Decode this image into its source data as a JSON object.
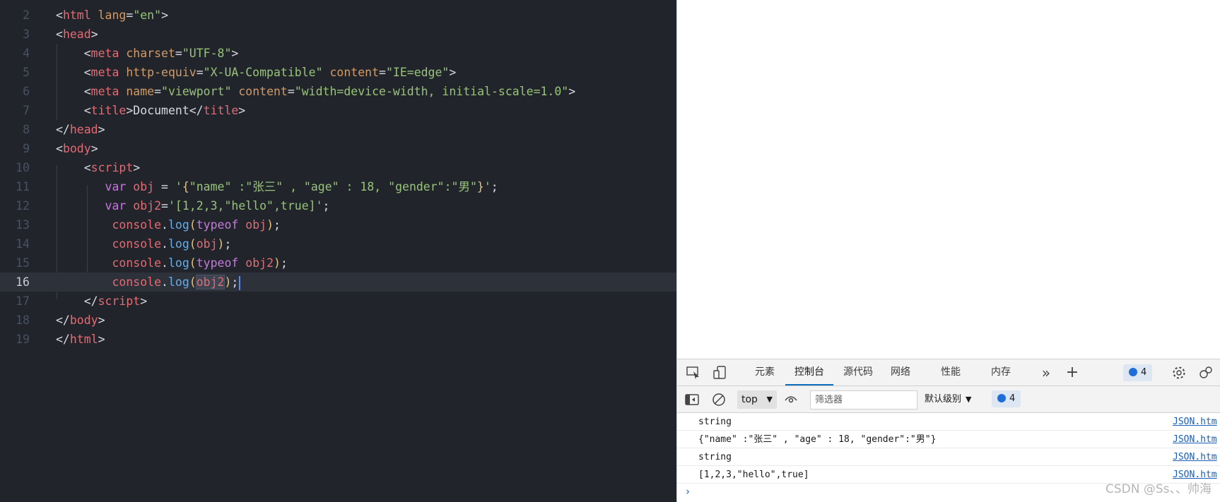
{
  "editor": {
    "lines": [
      {
        "num": "2",
        "current": false
      },
      {
        "num": "3",
        "current": false
      },
      {
        "num": "4",
        "current": false
      },
      {
        "num": "5",
        "current": false
      },
      {
        "num": "6",
        "current": false
      },
      {
        "num": "7",
        "current": false
      },
      {
        "num": "8",
        "current": false
      },
      {
        "num": "9",
        "current": false
      },
      {
        "num": "10",
        "current": false
      },
      {
        "num": "11",
        "current": false
      },
      {
        "num": "12",
        "current": false
      },
      {
        "num": "13",
        "current": false
      },
      {
        "num": "14",
        "current": false
      },
      {
        "num": "15",
        "current": false
      },
      {
        "num": "16",
        "current": true
      },
      {
        "num": "17",
        "current": false
      },
      {
        "num": "18",
        "current": false
      },
      {
        "num": "19",
        "current": false
      }
    ],
    "code": [
      [
        [
          "t-text",
          "<"
        ],
        [
          "t-tag",
          "html"
        ],
        [
          "t-text",
          " "
        ],
        [
          "t-attr",
          "lang"
        ],
        [
          "t-text",
          "="
        ],
        [
          "t-str",
          "\"en\""
        ],
        [
          "t-text",
          ">"
        ]
      ],
      [
        [
          "t-text",
          "<"
        ],
        [
          "t-tag",
          "head"
        ],
        [
          "t-text",
          ">"
        ]
      ],
      [
        [
          "t-text",
          "    <"
        ],
        [
          "t-tag",
          "meta"
        ],
        [
          "t-text",
          " "
        ],
        [
          "t-attr",
          "charset"
        ],
        [
          "t-text",
          "="
        ],
        [
          "t-str",
          "\"UTF-8\""
        ],
        [
          "t-text",
          ">"
        ]
      ],
      [
        [
          "t-text",
          "    <"
        ],
        [
          "t-tag",
          "meta"
        ],
        [
          "t-text",
          " "
        ],
        [
          "t-attr",
          "http-equiv"
        ],
        [
          "t-text",
          "="
        ],
        [
          "t-str",
          "\"X-UA-Compatible\""
        ],
        [
          "t-text",
          " "
        ],
        [
          "t-attr",
          "content"
        ],
        [
          "t-text",
          "="
        ],
        [
          "t-str",
          "\"IE=edge\""
        ],
        [
          "t-text",
          ">"
        ]
      ],
      [
        [
          "t-text",
          "    <"
        ],
        [
          "t-tag",
          "meta"
        ],
        [
          "t-text",
          " "
        ],
        [
          "t-attr",
          "name"
        ],
        [
          "t-text",
          "="
        ],
        [
          "t-str",
          "\"viewport\""
        ],
        [
          "t-text",
          " "
        ],
        [
          "t-attr",
          "content"
        ],
        [
          "t-text",
          "="
        ],
        [
          "t-str",
          "\"width=device-width, initial-scale=1.0\""
        ],
        [
          "t-text",
          ">"
        ]
      ],
      [
        [
          "t-text",
          "    <"
        ],
        [
          "t-tag",
          "title"
        ],
        [
          "t-text",
          ">Document</"
        ],
        [
          "t-tag",
          "title"
        ],
        [
          "t-text",
          ">"
        ]
      ],
      [
        [
          "t-text",
          "</"
        ],
        [
          "t-tag",
          "head"
        ],
        [
          "t-text",
          ">"
        ]
      ],
      [
        [
          "t-text",
          "<"
        ],
        [
          "t-tag",
          "body"
        ],
        [
          "t-text",
          ">"
        ]
      ],
      [
        [
          "t-text",
          "    <"
        ],
        [
          "t-tag",
          "script"
        ],
        [
          "t-text",
          ">"
        ]
      ],
      [
        [
          "t-text",
          "       "
        ],
        [
          "t-kw",
          "var"
        ],
        [
          "t-text",
          " "
        ],
        [
          "t-ident",
          "obj"
        ],
        [
          "t-text",
          " = "
        ],
        [
          "t-str",
          "'"
        ],
        [
          "t-br1",
          "{"
        ],
        [
          "t-str",
          "\"name\" :\"张三\" , \"age\" : 18, \"gender\":\"男\""
        ],
        [
          "t-br1",
          "}"
        ],
        [
          "t-str",
          "'"
        ],
        [
          "t-text",
          ";"
        ]
      ],
      [
        [
          "t-text",
          "       "
        ],
        [
          "t-kw",
          "var"
        ],
        [
          "t-text",
          " "
        ],
        [
          "t-ident",
          "obj2"
        ],
        [
          "t-text",
          "="
        ],
        [
          "t-str",
          "'[1,2,3,\"hello\",true]'"
        ],
        [
          "t-text",
          ";"
        ]
      ],
      [
        [
          "t-text",
          "        "
        ],
        [
          "t-ident",
          "console"
        ],
        [
          "t-text",
          "."
        ],
        [
          "t-fn",
          "log"
        ],
        [
          "t-br1",
          "("
        ],
        [
          "t-kw",
          "typeof"
        ],
        [
          "t-text",
          " "
        ],
        [
          "t-ident",
          "obj"
        ],
        [
          "t-br1",
          ")"
        ],
        [
          "t-text",
          ";"
        ]
      ],
      [
        [
          "t-text",
          "        "
        ],
        [
          "t-ident",
          "console"
        ],
        [
          "t-text",
          "."
        ],
        [
          "t-fn",
          "log"
        ],
        [
          "t-br1",
          "("
        ],
        [
          "t-ident",
          "obj"
        ],
        [
          "t-br1",
          ")"
        ],
        [
          "t-text",
          ";"
        ]
      ],
      [
        [
          "t-text",
          "        "
        ],
        [
          "t-ident",
          "console"
        ],
        [
          "t-text",
          "."
        ],
        [
          "t-fn",
          "log"
        ],
        [
          "t-br1",
          "("
        ],
        [
          "t-kw",
          "typeof"
        ],
        [
          "t-text",
          " "
        ],
        [
          "t-ident",
          "obj2"
        ],
        [
          "t-br1",
          ")"
        ],
        [
          "t-text",
          ";"
        ]
      ],
      [
        [
          "t-text",
          "        "
        ],
        [
          "t-ident",
          "console"
        ],
        [
          "t-text",
          "."
        ],
        [
          "t-fn",
          "log"
        ],
        [
          "t-br1",
          "("
        ],
        [
          "t-ident t-hl",
          "obj2"
        ],
        [
          "t-br1",
          ")"
        ],
        [
          "t-text",
          ";"
        ]
      ],
      [
        [
          "t-text",
          "    </"
        ],
        [
          "t-tag",
          "script"
        ],
        [
          "t-text",
          ">"
        ]
      ],
      [
        [
          "t-text",
          "</"
        ],
        [
          "t-tag",
          "body"
        ],
        [
          "t-text",
          ">"
        ]
      ],
      [
        [
          "t-text",
          "</"
        ],
        [
          "t-tag",
          "html"
        ],
        [
          "t-text",
          ">"
        ]
      ]
    ]
  },
  "devtools": {
    "tabs": [
      "元素",
      "控制台",
      "源代码",
      "网络",
      "性能",
      "内存"
    ],
    "active_tab": "控制台",
    "issues_count": "4",
    "context": "top",
    "filter_placeholder": "筛选器",
    "levels": "默认级别",
    "toolbar_issues_count": "4",
    "icons": {
      "inspect": "inspect-element-icon",
      "device": "device-emulation-icon",
      "more_tabs": "more-tabs-icon",
      "add_tab": "add-tab-icon",
      "settings": "settings-icon",
      "feedback": "feedback-icon",
      "sidebar": "sidebar-toggle-icon",
      "clear": "clear-console-icon",
      "live_expression": "eye-icon"
    }
  },
  "console": {
    "logs": [
      {
        "message": "string",
        "source": "JSON.htm"
      },
      {
        "message": "{\"name\" :\"张三\" , \"age\" : 18, \"gender\":\"男\"}",
        "source": "JSON.htm"
      },
      {
        "message": "string",
        "source": "JSON.htm"
      },
      {
        "message": "[1,2,3,\"hello\",true]",
        "source": "JSON.htm"
      }
    ],
    "prompt": "›"
  },
  "watermark": "CSDN @Ss、、帅海",
  "colors": {
    "editor_bg": "#21252b",
    "active_tab_underline": "#0f6cbd",
    "link": "#1a5fb4"
  }
}
